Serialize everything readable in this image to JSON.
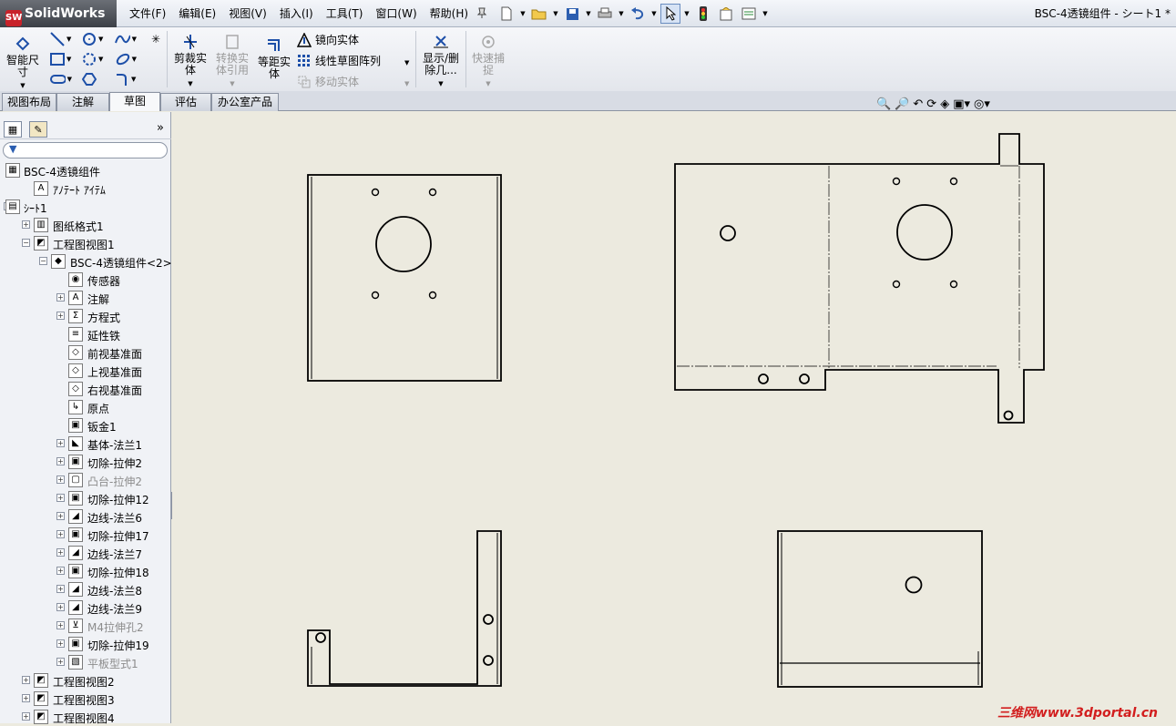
{
  "app": {
    "logo": "SolidWorks",
    "logo_badge": "SW",
    "doc_title": "BSC-4透镜组件 - シート1 *"
  },
  "menu": [
    "文件(F)",
    "编辑(E)",
    "视图(V)",
    "插入(I)",
    "工具(T)",
    "窗口(W)",
    "帮助(H)"
  ],
  "quick_access": [
    "new-document-icon",
    "open-icon",
    "save-icon",
    "print-icon",
    "undo-icon",
    "select-icon",
    "rebuild-icon",
    "file-properties-icon",
    "options-icon"
  ],
  "commands": {
    "smart_dim": "智能尺寸",
    "trim": "剪裁实体",
    "convert": "转换实体引用",
    "offset": "等距实体",
    "mirror": "镜向实体",
    "linear_pattern": "线性草图阵列",
    "move": "移动实体",
    "show_hide": "显示/删除几...",
    "quick_snap": "快速捕捉"
  },
  "tabs": [
    "视图布局",
    "注解",
    "草图",
    "评估",
    "办公室产品"
  ],
  "active_tab": "草图",
  "tree": [
    {
      "label": "BSC-4透镜组件",
      "icon": "drawing-icon",
      "indent": 0,
      "ex": ""
    },
    {
      "label": "ｱﾉﾃｰﾄ ｱｲﾃﾑ",
      "icon": "annotation-icon",
      "indent": 1,
      "ex": ""
    },
    {
      "label": "ｼｰﾄ1",
      "icon": "sheet-icon",
      "indent": 0,
      "ex": "−"
    },
    {
      "label": "图纸格式1",
      "icon": "sheet-format-icon",
      "indent": 1,
      "ex": "+"
    },
    {
      "label": "工程图视图1",
      "icon": "drawing-view-icon",
      "indent": 1,
      "ex": "−"
    },
    {
      "label": "BSC-4透镜组件<2>",
      "icon": "part-icon",
      "indent": 2,
      "ex": "−"
    },
    {
      "label": "传感器",
      "icon": "sensor-icon",
      "indent": 3,
      "ex": ""
    },
    {
      "label": "注解",
      "icon": "annotation-icon",
      "indent": 3,
      "ex": "+"
    },
    {
      "label": "方程式",
      "icon": "equation-icon",
      "indent": 3,
      "ex": "+"
    },
    {
      "label": "延性铁",
      "icon": "material-icon",
      "indent": 3,
      "ex": ""
    },
    {
      "label": "前视基准面",
      "icon": "plane-icon",
      "indent": 3,
      "ex": ""
    },
    {
      "label": "上视基准面",
      "icon": "plane-icon",
      "indent": 3,
      "ex": ""
    },
    {
      "label": "右视基准面",
      "icon": "plane-icon",
      "indent": 3,
      "ex": ""
    },
    {
      "label": "原点",
      "icon": "origin-icon",
      "indent": 3,
      "ex": ""
    },
    {
      "label": "钣金1",
      "icon": "sheet-metal-icon",
      "indent": 3,
      "ex": ""
    },
    {
      "label": "基体-法兰1",
      "icon": "base-flange-icon",
      "indent": 3,
      "ex": "+"
    },
    {
      "label": "切除-拉伸2",
      "icon": "cut-extrude-icon",
      "indent": 3,
      "ex": "+"
    },
    {
      "label": "凸台-拉伸2",
      "icon": "boss-extrude-icon",
      "indent": 3,
      "ex": "+",
      "gray": true
    },
    {
      "label": "切除-拉伸12",
      "icon": "cut-extrude-icon",
      "indent": 3,
      "ex": "+"
    },
    {
      "label": "边线-法兰6",
      "icon": "edge-flange-icon",
      "indent": 3,
      "ex": "+"
    },
    {
      "label": "切除-拉伸17",
      "icon": "cut-extrude-icon",
      "indent": 3,
      "ex": "+"
    },
    {
      "label": "边线-法兰7",
      "icon": "edge-flange-icon",
      "indent": 3,
      "ex": "+"
    },
    {
      "label": "切除-拉伸18",
      "icon": "cut-extrude-icon",
      "indent": 3,
      "ex": "+"
    },
    {
      "label": "边线-法兰8",
      "icon": "edge-flange-icon",
      "indent": 3,
      "ex": "+"
    },
    {
      "label": "边线-法兰9",
      "icon": "edge-flange-icon",
      "indent": 3,
      "ex": "+"
    },
    {
      "label": "M4拉伸孔2",
      "icon": "hole-icon",
      "indent": 3,
      "ex": "+",
      "gray": true
    },
    {
      "label": "切除-拉伸19",
      "icon": "cut-extrude-icon",
      "indent": 3,
      "ex": "+"
    },
    {
      "label": "平板型式1",
      "icon": "flat-pattern-icon",
      "indent": 3,
      "ex": "+",
      "gray": true
    },
    {
      "label": "工程图视图2",
      "icon": "drawing-view-icon",
      "indent": 1,
      "ex": "+"
    },
    {
      "label": "工程图视图3",
      "icon": "drawing-view-icon",
      "indent": 1,
      "ex": "+"
    },
    {
      "label": "工程图视图4",
      "icon": "drawing-view-icon",
      "indent": 1,
      "ex": "+"
    }
  ],
  "watermark": "三维网www.3dportal.cn"
}
